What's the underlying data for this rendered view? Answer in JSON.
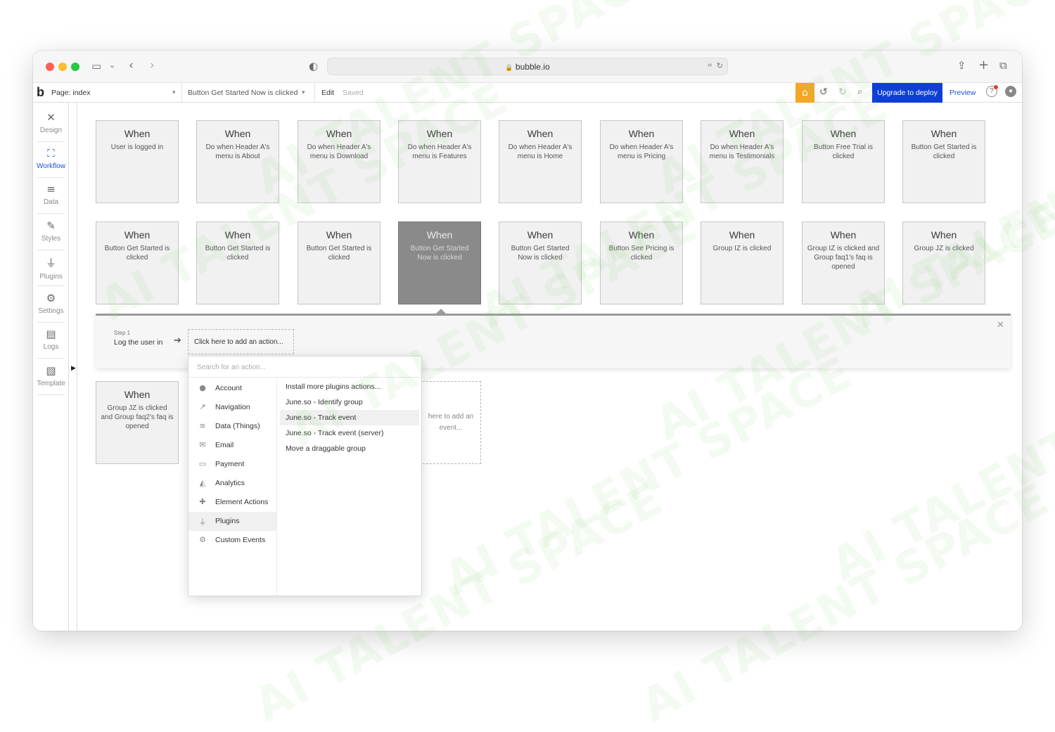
{
  "browser": {
    "url": "bubble.io",
    "colors": {
      "close": "#fe5f57",
      "minimize": "#febc2e",
      "zoom": "#28c840"
    }
  },
  "appbar": {
    "page_label": "Page: index",
    "event_selector": "Button Get Started Now is clicked",
    "edit_label": "Edit",
    "saved_label": "Saved",
    "upgrade_label": "Upgrade to deploy",
    "preview_label": "Preview",
    "colors": {
      "accent": "#1f4fd8",
      "gift": "#f5a623"
    }
  },
  "leftnav": {
    "items": [
      {
        "label": "Design",
        "icon": "design-icon",
        "active": false
      },
      {
        "label": "Workflow",
        "icon": "workflow-icon",
        "active": true
      },
      {
        "label": "Data",
        "icon": "database-icon",
        "active": false
      },
      {
        "label": "Styles",
        "icon": "brush-icon",
        "active": false
      },
      {
        "label": "Plugins",
        "icon": "plugin-icon",
        "active": false
      },
      {
        "label": "Settings",
        "icon": "gear-icon",
        "active": false
      },
      {
        "label": "Logs",
        "icon": "document-icon",
        "active": false
      },
      {
        "label": "Template",
        "icon": "template-icon",
        "active": false
      }
    ]
  },
  "events": [
    {
      "when": "When",
      "desc": "User is logged in"
    },
    {
      "when": "When",
      "desc": "Do when Header A's menu is About"
    },
    {
      "when": "When",
      "desc": "Do when Header A's menu is Download"
    },
    {
      "when": "When",
      "desc": "Do when Header A's menu is Features"
    },
    {
      "when": "When",
      "desc": "Do when Header A's menu is Home"
    },
    {
      "when": "When",
      "desc": "Do when Header A's menu is Pricing"
    },
    {
      "when": "When",
      "desc": "Do when Header A's menu is Testimonials"
    },
    {
      "when": "When",
      "desc": "Button Free Trial is clicked"
    },
    {
      "when": "When",
      "desc": "Button Get Started is clicked"
    },
    {
      "when": "When",
      "desc": "Button Get Started is clicked"
    },
    {
      "when": "When",
      "desc": "Button Get Started is clicked"
    },
    {
      "when": "When",
      "desc": "Button Get Started is clicked"
    },
    {
      "when": "When",
      "desc": "Button Get Started Now is clicked"
    },
    {
      "when": "When",
      "desc": "Button Get Started Now is clicked"
    },
    {
      "when": "When",
      "desc": "Button See Pricing is clicked"
    },
    {
      "when": "When",
      "desc": "Group IZ is clicked"
    },
    {
      "when": "When",
      "desc": "Group IZ is clicked and Group faq1's faq is opened"
    },
    {
      "when": "When",
      "desc": "Group JZ is clicked"
    },
    {
      "when": "When",
      "desc": "Group JZ is clicked and Group faq2's faq is opened"
    }
  ],
  "workflow": {
    "step_label": "Step 1",
    "step_name": "Log the user in",
    "add_action": "Click here to add an action...",
    "add_event_partial": "here to add an event..."
  },
  "action_menu": {
    "search_placeholder": "Search for an action...",
    "categories": [
      {
        "label": "Account",
        "icon": "account-icon"
      },
      {
        "label": "Navigation",
        "icon": "navigation-icon"
      },
      {
        "label": "Data (Things)",
        "icon": "database-icon"
      },
      {
        "label": "Email",
        "icon": "email-icon"
      },
      {
        "label": "Payment",
        "icon": "payment-icon"
      },
      {
        "label": "Analytics",
        "icon": "analytics-icon"
      },
      {
        "label": "Element Actions",
        "icon": "element-actions-icon"
      },
      {
        "label": "Plugins",
        "icon": "plugin-icon"
      },
      {
        "label": "Custom Events",
        "icon": "custom-events-icon"
      }
    ],
    "actions": [
      "Install more plugins actions...",
      "June.so - Identify group",
      "June.so - Track event",
      "June.so - Track event (server)",
      "Move a draggable group"
    ]
  },
  "watermark": "AI TALENT SPACE"
}
